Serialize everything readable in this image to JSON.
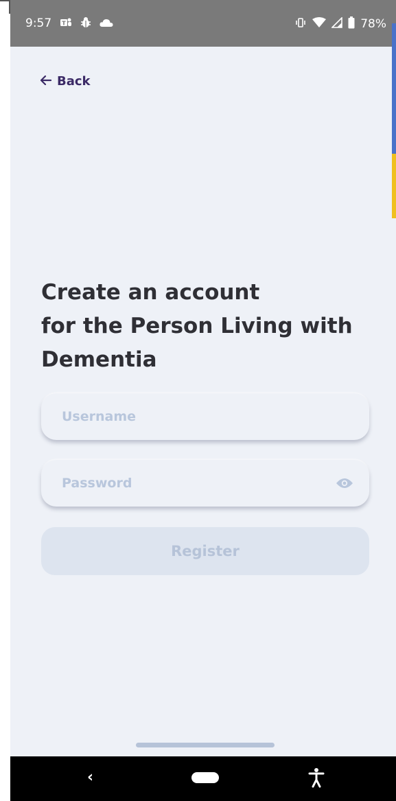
{
  "status_bar": {
    "time": "9:57",
    "battery": "78%",
    "icons_left": [
      "teams-icon",
      "bug-icon",
      "cloud-icon"
    ],
    "icons_right": [
      "vibrate-icon",
      "wifi-icon",
      "signal-icon",
      "battery-icon"
    ]
  },
  "header": {
    "back_label": "Back"
  },
  "title": {
    "line1": "Create an account",
    "line2": "for the Person Living with",
    "line3": "Dementia"
  },
  "form": {
    "username_placeholder": "Username",
    "username_value": "",
    "password_placeholder": "Password",
    "password_value": "",
    "register_label": "Register"
  },
  "nav_bar": {
    "back_glyph": "‹"
  },
  "colors": {
    "background": "#eef1f7",
    "status_bar": "#7a7a7a",
    "back_link": "#3b2a66",
    "title": "#2f2f35",
    "placeholder": "#b8c6dc",
    "button_bg": "#dde4ef",
    "button_text": "#b6c3d8",
    "accent_blue": "#4a72c9",
    "accent_yellow": "#f0c020"
  }
}
